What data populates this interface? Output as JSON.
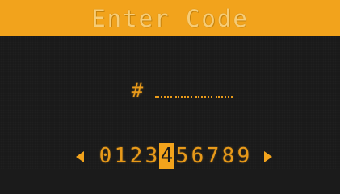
{
  "header": {
    "title": "Enter Code"
  },
  "entry": {
    "prefix": "#",
    "slot_count": 4
  },
  "picker": {
    "digits": [
      "0",
      "1",
      "2",
      "3",
      "4",
      "5",
      "6",
      "7",
      "8",
      "9"
    ],
    "selected_index": 4
  },
  "colors": {
    "accent": "#f2a31c",
    "background": "#1a1a1a",
    "text": "#e89a1a"
  },
  "icons": {
    "left": "arrow-left-icon",
    "right": "arrow-right-icon"
  }
}
